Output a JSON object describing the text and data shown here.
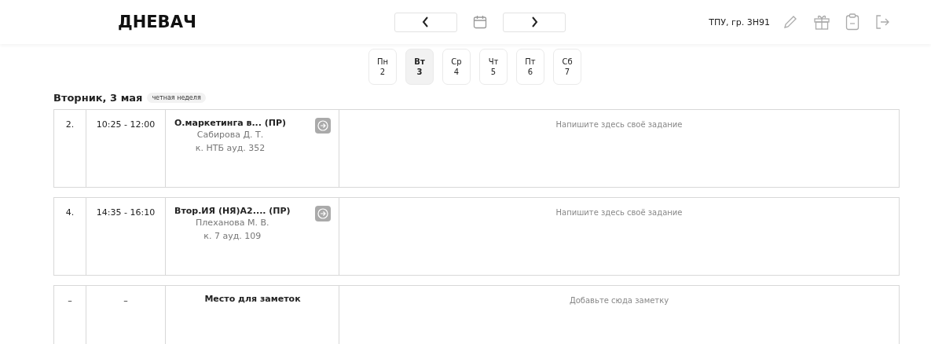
{
  "header": {
    "logo": "ДНЕВАЧ",
    "group": "ТПУ, гр. 3Н91"
  },
  "days": [
    {
      "name": "Пн",
      "date": "2",
      "selected": false
    },
    {
      "name": "Вт",
      "date": "3",
      "selected": true
    },
    {
      "name": "Ср",
      "date": "4",
      "selected": false
    },
    {
      "name": "Чт",
      "date": "5",
      "selected": false
    },
    {
      "name": "Пт",
      "date": "6",
      "selected": false
    },
    {
      "name": "Сб",
      "date": "7",
      "selected": false
    }
  ],
  "day_heading": {
    "title": "Вторник, 3 мая",
    "week": "четная неделя"
  },
  "rows": [
    {
      "kind": "lesson",
      "number": "2.",
      "time": "10:25 - 12:00",
      "subject": "О.маркетинга в... (ПР)",
      "teacher": "Сабирова Д. Т.",
      "room": "к. НТБ ауд. 352",
      "task_placeholder": "Напишите здесь своё задание"
    },
    {
      "kind": "lesson",
      "number": "4.",
      "time": "14:35 - 16:10",
      "subject": "Втор.ИЯ (НЯ)А2.... (ПР)",
      "teacher": "Плеханова М. В.",
      "room": "к. 7 ауд. 109",
      "task_placeholder": "Напишите здесь своё задание"
    },
    {
      "kind": "note",
      "number": "–",
      "time": "–",
      "subject": "Место для заметок",
      "task_placeholder": "Добавьте сюда заметку"
    }
  ]
}
